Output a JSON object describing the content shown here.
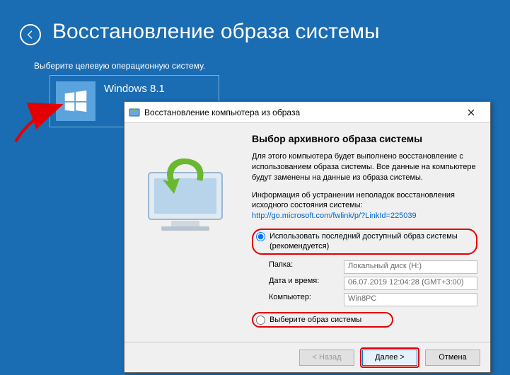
{
  "page": {
    "title": "Восстановление образа системы",
    "subtitle": "Выберите целевую операционную систему."
  },
  "os_tile": {
    "name": "Windows 8.1"
  },
  "dialog": {
    "title": "Восстановление компьютера из образа",
    "heading": "Выбор архивного образа системы",
    "para1": "Для этого компьютера будет выполнено восстановление с использованием образа системы. Все данные на компьютере будут заменены на данные из образа системы.",
    "para2_prefix": "Информация об устранении неполадок восстановления исходного состояния системы:",
    "para2_link": "http://go.microsoft.com/fwlink/p/?LinkId=225039",
    "radio1": "Использовать последний доступный образ системы (рекомендуется)",
    "radio2": "Выберите образ системы",
    "fields": {
      "folder_label": "Папка:",
      "folder_value": "Локальный диск (H:)",
      "datetime_label": "Дата и время:",
      "datetime_value": "06.07.2019 12:04:28 (GMT+3:00)",
      "computer_label": "Компьютер:",
      "computer_value": "Win8PC"
    },
    "buttons": {
      "back": "< Назад",
      "next": "Далее >",
      "cancel": "Отмена"
    }
  }
}
